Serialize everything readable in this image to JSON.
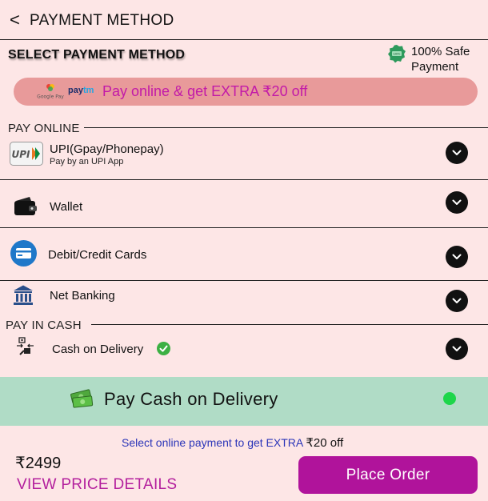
{
  "header": {
    "back_glyph": "<",
    "title": "PAYMENT METHOD"
  },
  "section_title": "SELECT PAYMENT METHOD",
  "safe_badge": {
    "line1": "100% Safe",
    "line2": "Payment",
    "icon": "secure-shield-icon"
  },
  "promo": {
    "gpay_label": "Google Pay",
    "paytm_a": "pay",
    "paytm_b": "tm",
    "text": "Pay online & get EXTRA ₹20 off"
  },
  "groups": {
    "online": "PAY ONLINE",
    "cash": "PAY IN CASH"
  },
  "options": {
    "upi": {
      "logo": "UPI",
      "title": "UPI(Gpay/Phonepay)",
      "subtitle": "Pay by an UPI App",
      "icon": "upi-icon"
    },
    "wallet": {
      "title": "Wallet",
      "icon": "wallet-icon"
    },
    "cards": {
      "title": "Debit/Credit Cards",
      "icon": "card-icon"
    },
    "netbanking": {
      "title": "Net Banking",
      "icon": "bank-icon"
    },
    "cod": {
      "title": "Cash on Delivery",
      "icon": "cash-delivery-icon",
      "verified_icon": "check-circle-icon"
    }
  },
  "cod_bar": {
    "text": "Pay Cash on Delivery",
    "icon": "money-icon",
    "selected": true
  },
  "hint": {
    "text": "Select online payment to get EXTRA ",
    "amount": "₹20 off"
  },
  "footer": {
    "price": "₹2499",
    "details_link": "VIEW PRICE DETAILS",
    "button": "Place Order"
  },
  "colors": {
    "background": "#fde6e6",
    "accent": "#b0139b",
    "promo_bg": "#e89a9a",
    "promo_text": "#c21aa8",
    "cod_bg": "#b0dcc6",
    "selected_dot": "#1dd64a",
    "hint_text": "#2b35b8"
  }
}
